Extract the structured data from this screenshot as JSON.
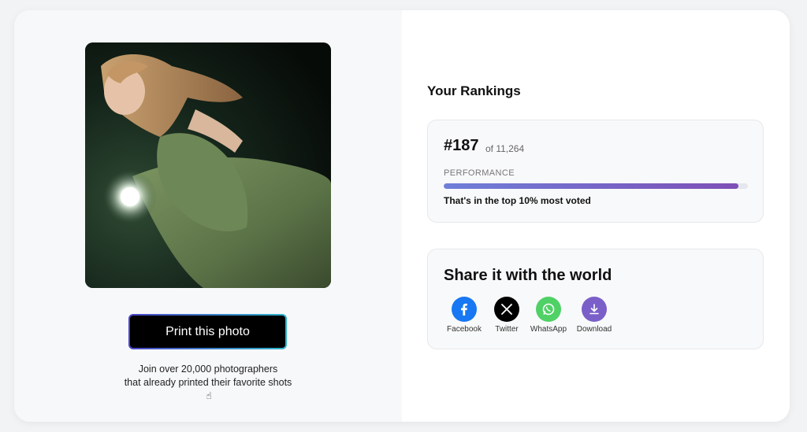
{
  "print_button": {
    "label": "Print this photo"
  },
  "join": {
    "line1": "Join over 20,000 photographers",
    "line2": "that already printed their favorite shots"
  },
  "rankings": {
    "title": "Your Rankings",
    "rank": "#187",
    "of_total": "of 11,264",
    "performance_label": "PERFORMANCE",
    "performance_fraction": 0.97,
    "performance_text": "That's in the top 10% most voted"
  },
  "share": {
    "title": "Share it with the world",
    "items": [
      {
        "label": "Facebook",
        "icon": "facebook-icon",
        "color": "#1877f2"
      },
      {
        "label": "Twitter",
        "icon": "x-icon",
        "color": "#000000"
      },
      {
        "label": "WhatsApp",
        "icon": "whatsapp-icon",
        "color": "#4fd166"
      },
      {
        "label": "Download",
        "icon": "download-icon",
        "color": "#7a5fc8"
      }
    ]
  },
  "colors": {
    "accent_gradient_start": "#6f7fd8",
    "accent_gradient_end": "#7e4fb7",
    "button_border_start": "#4b46c8",
    "button_border_end": "#2fb3c9"
  }
}
